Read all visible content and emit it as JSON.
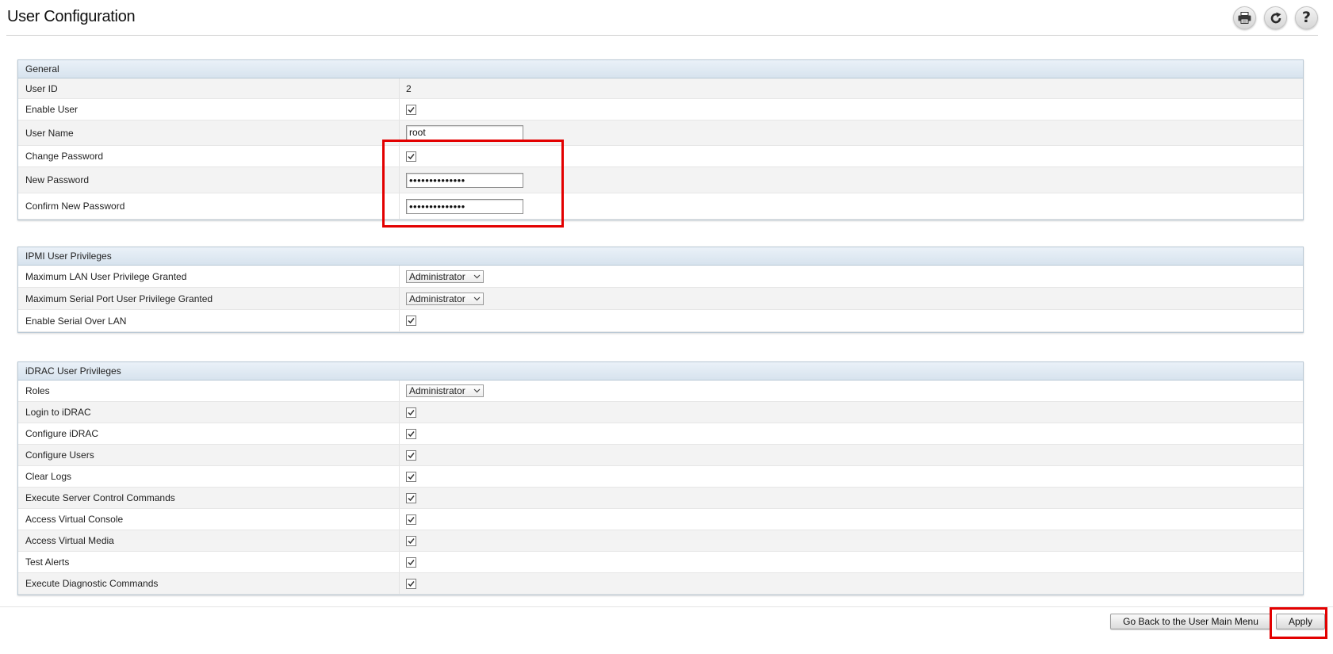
{
  "page": {
    "title": "User Configuration"
  },
  "header_icons": [
    "print-icon",
    "refresh-icon",
    "help-icon"
  ],
  "general": {
    "title": "General",
    "user_id_label": "User ID",
    "user_id_value": "2",
    "enable_user_label": "Enable User",
    "enable_user_checked": true,
    "user_name_label": "User Name",
    "user_name_value": "root",
    "change_password_label": "Change Password",
    "change_password_checked": true,
    "new_password_label": "New Password",
    "new_password_value": "••••••••••••••",
    "confirm_password_label": "Confirm New Password",
    "confirm_password_value": "••••••••••••••"
  },
  "ipmi": {
    "title": "IPMI User Privileges",
    "lan_label": "Maximum LAN User Privilege Granted",
    "lan_value": "Administrator",
    "serial_label": "Maximum Serial Port User Privilege Granted",
    "serial_value": "Administrator",
    "sol_label": "Enable Serial Over LAN",
    "sol_checked": true
  },
  "idrac": {
    "title": "iDRAC User Privileges",
    "roles_label": "Roles",
    "roles_value": "Administrator",
    "privileges": [
      {
        "label": "Login to iDRAC",
        "checked": true
      },
      {
        "label": "Configure iDRAC",
        "checked": true
      },
      {
        "label": "Configure Users",
        "checked": true
      },
      {
        "label": "Clear Logs",
        "checked": true
      },
      {
        "label": "Execute Server Control Commands",
        "checked": true
      },
      {
        "label": "Access Virtual Console",
        "checked": true
      },
      {
        "label": "Access Virtual Media",
        "checked": true
      },
      {
        "label": "Test Alerts",
        "checked": true
      },
      {
        "label": "Execute Diagnostic Commands",
        "checked": true
      }
    ]
  },
  "footer": {
    "back_label": "Go Back to the User Main Menu",
    "apply_label": "Apply"
  },
  "colors": {
    "highlight": "#e30000",
    "panel_header": "#dce7f1",
    "panel_border": "#b9c8d5"
  }
}
